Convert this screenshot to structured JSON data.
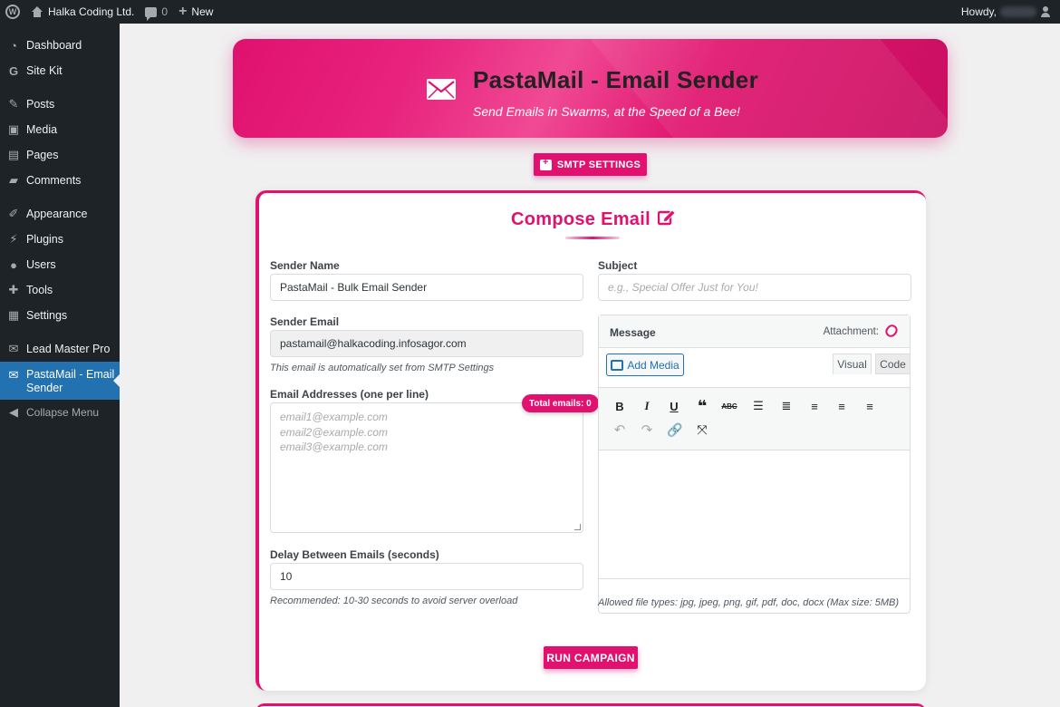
{
  "adminbar": {
    "site_name": "Halka Coding Ltd.",
    "comments_count": "0",
    "new_label": "New",
    "howdy": "Howdy,"
  },
  "sidebar": {
    "items": [
      {
        "label": "Dashboard",
        "icon": "dashboard-icon"
      },
      {
        "label": "Site Kit",
        "icon": "google-g-icon"
      },
      {
        "label": "Posts",
        "icon": "pin-icon"
      },
      {
        "label": "Media",
        "icon": "media-icon"
      },
      {
        "label": "Pages",
        "icon": "pages-icon"
      },
      {
        "label": "Comments",
        "icon": "comment-icon"
      },
      {
        "label": "Appearance",
        "icon": "brush-icon"
      },
      {
        "label": "Plugins",
        "icon": "plug-icon"
      },
      {
        "label": "Users",
        "icon": "user-icon"
      },
      {
        "label": "Tools",
        "icon": "wrench-icon"
      },
      {
        "label": "Settings",
        "icon": "sliders-icon"
      },
      {
        "label": "Lead Master Pro",
        "icon": "mail-icon"
      },
      {
        "label": "PastaMail - Email Sender",
        "icon": "mail-icon"
      },
      {
        "label": "Collapse Menu",
        "icon": "collapse-icon"
      }
    ],
    "active_index": 12
  },
  "banner": {
    "title": "PastaMail - Email Sender",
    "subtitle": "Send Emails in Swarms, at the Speed of a Bee!"
  },
  "smtp_button": "SMTP SETTINGS",
  "compose": {
    "title": "Compose Email",
    "sender_name_label": "Sender Name",
    "sender_name_value": "PastaMail - Bulk Email Sender",
    "sender_email_label": "Sender Email",
    "sender_email_value": "pastamail@halkacoding.infosagor.com",
    "sender_email_hint": "This email is automatically set from SMTP Settings",
    "addresses_label": "Email Addresses (one per line)",
    "addresses_placeholder_lines": [
      "email1@example.com",
      "email2@example.com",
      "email3@example.com"
    ],
    "total_emails": "Total emails: 0",
    "delay_label": "Delay Between Emails (seconds)",
    "delay_value": "10",
    "delay_hint": "Recommended: 10-30 seconds to avoid server overload",
    "subject_label": "Subject",
    "subject_placeholder": "e.g., Special Offer Just for You!",
    "message_label": "Message",
    "attachment_label": "Attachment:",
    "add_media": "Add Media",
    "tab_visual": "Visual",
    "tab_code": "Code",
    "allowed_types": "Allowed file types: jpg, jpeg, png, gif, pdf, doc, docx (Max size: 5MB)",
    "run_button": "RUN CAMPAIGN"
  },
  "colors": {
    "accent": "#e0116f",
    "admin_dark": "#1d2327",
    "active_blue": "#2271b1"
  }
}
